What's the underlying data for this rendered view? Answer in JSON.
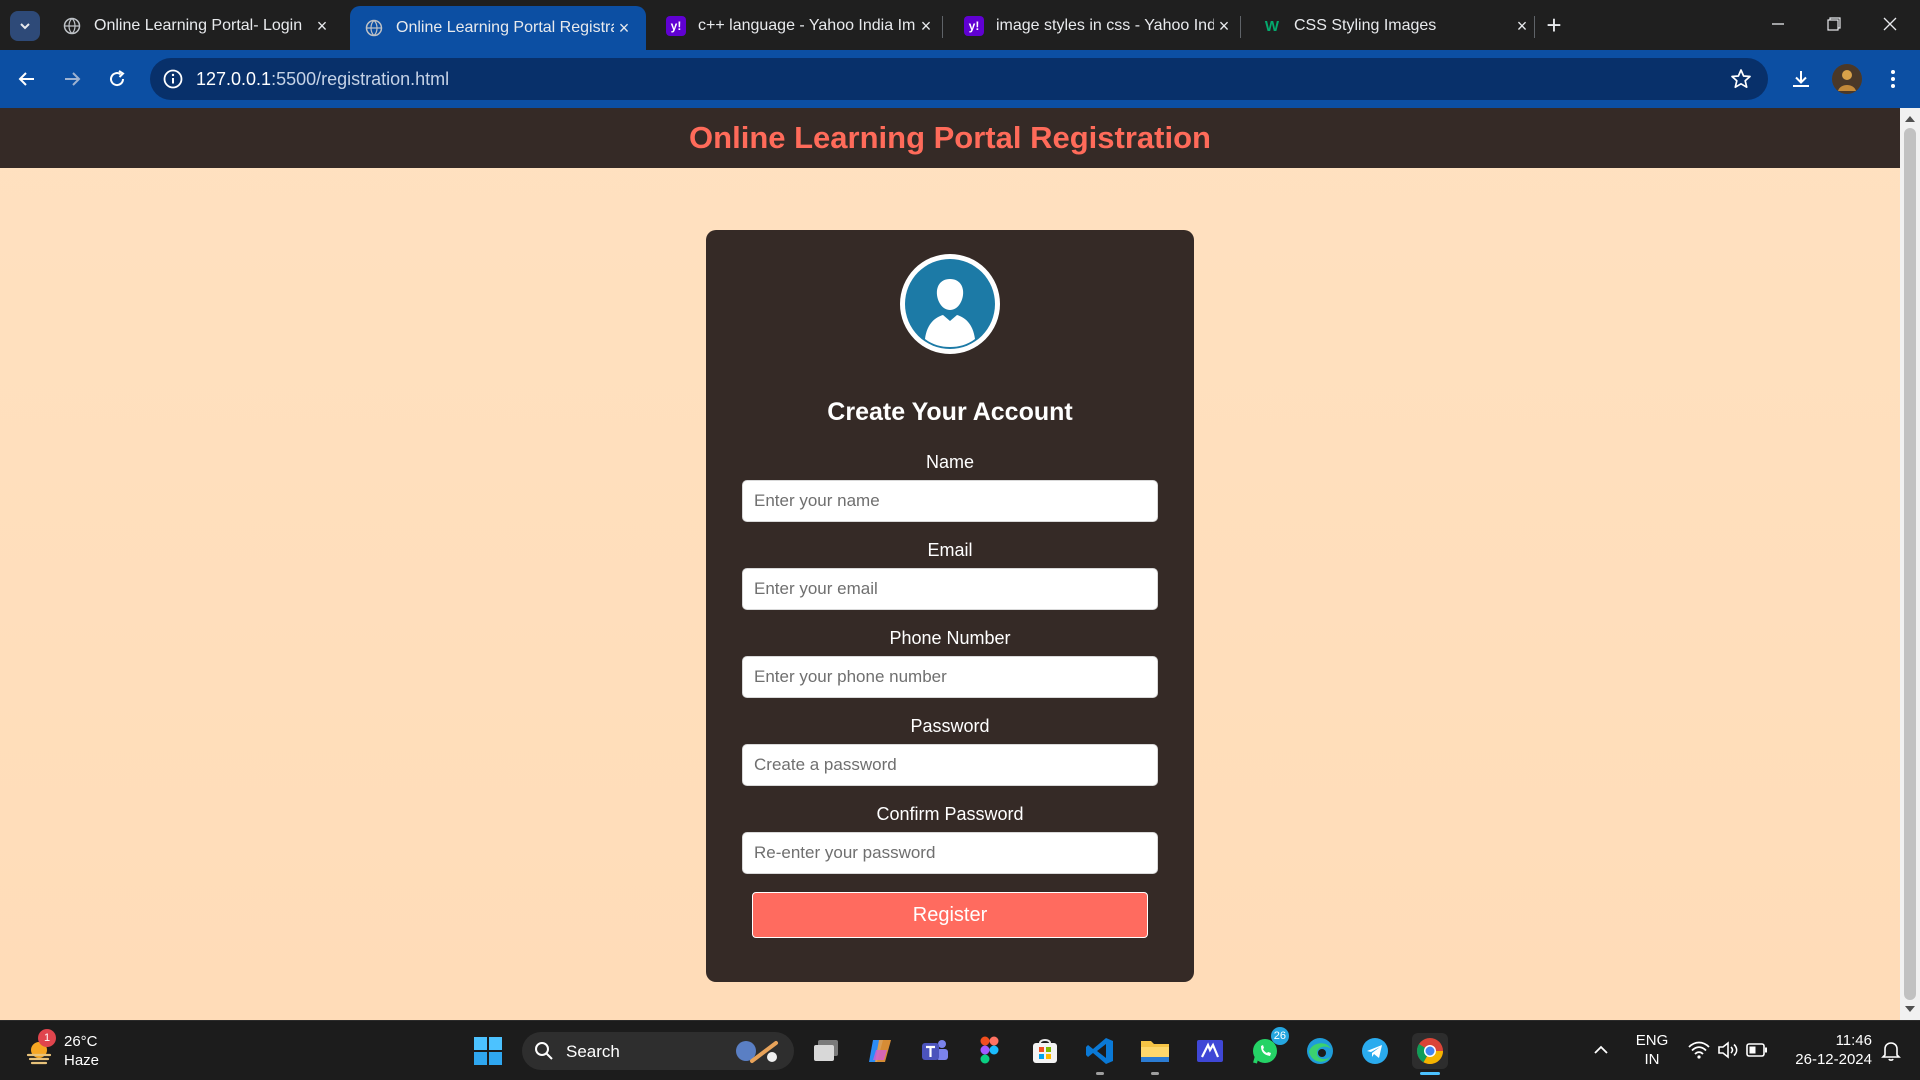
{
  "browser": {
    "tabs": [
      {
        "title": "Online Learning Portal- Login",
        "favicon": "globe-icon",
        "active": false
      },
      {
        "title": "Online Learning Portal Registrat",
        "favicon": "globe-icon",
        "active": true
      },
      {
        "title": "c++ language - Yahoo India Ima",
        "favicon": "yahoo-icon",
        "active": false
      },
      {
        "title": "image styles in css - Yahoo Indi",
        "favicon": "yahoo-icon",
        "active": false
      },
      {
        "title": "CSS Styling Images",
        "favicon": "w3schools-icon",
        "active": false
      }
    ],
    "url_host": "127.0.0.1",
    "url_rest": ":5500/registration.html",
    "accent": "#0c4fa3"
  },
  "page": {
    "header_title": "Online Learning Portal Registration",
    "form": {
      "heading": "Create Your Account",
      "fields": [
        {
          "label": "Name",
          "placeholder": "Enter your name"
        },
        {
          "label": "Email",
          "placeholder": "Enter your email"
        },
        {
          "label": "Phone Number",
          "placeholder": "Enter your phone number"
        },
        {
          "label": "Password",
          "placeholder": "Create a password"
        },
        {
          "label": "Confirm Password",
          "placeholder": "Re-enter your password"
        }
      ],
      "submit_label": "Register"
    },
    "colors": {
      "background": "#ffe0bf",
      "card": "#352a26",
      "title": "#ff6b5a",
      "button": "#ff6b5f",
      "avatar": "#1c7aa6"
    }
  },
  "taskbar": {
    "weather": {
      "temp": "26°C",
      "condition": "Haze",
      "badge": "1"
    },
    "search_label": "Search",
    "whatsapp_badge": "26",
    "language": {
      "line1": "ENG",
      "line2": "IN"
    },
    "time": "11:46",
    "date": "26-12-2024"
  }
}
